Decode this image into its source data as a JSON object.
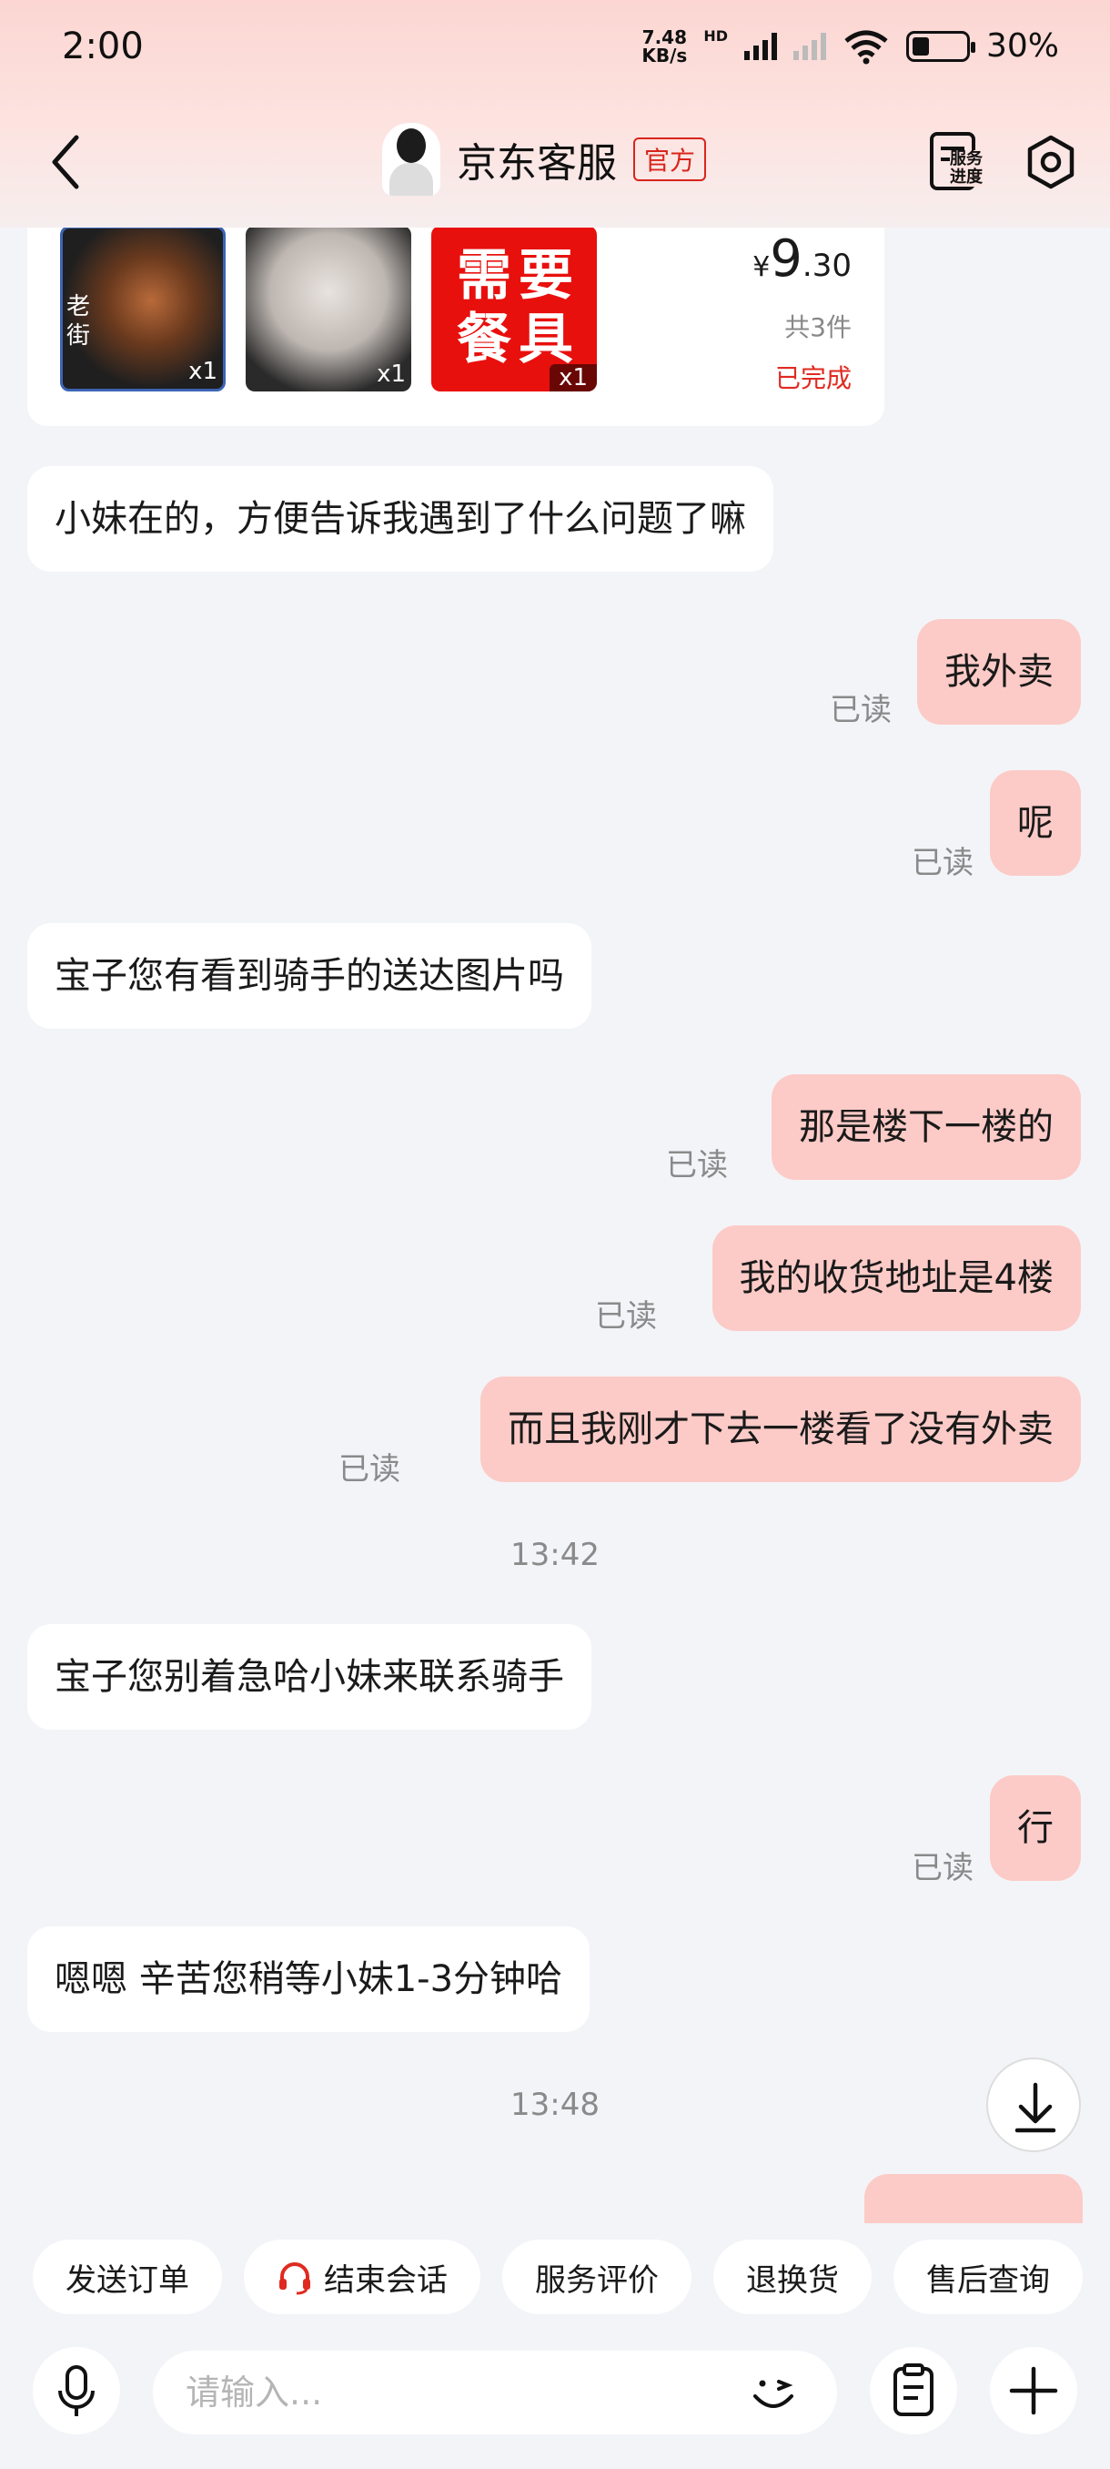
{
  "status_bar": {
    "time": "2:00",
    "net_speed_top": "7.48",
    "net_speed_bottom": "KB/s",
    "hd": "HD",
    "battery": "30%"
  },
  "header": {
    "title": "京东客服",
    "badge": "官方",
    "service_progress": "服务进度",
    "service_progress_line1": "服务",
    "service_progress_line2": "进度"
  },
  "order_card": {
    "items": [
      {
        "qty": "x1",
        "sign": "老街"
      },
      {
        "qty": "x1"
      },
      {
        "qty": "x1",
        "label": "需要餐具"
      }
    ],
    "thumb3_line1": "需要",
    "thumb3_line2": "餐具",
    "price_currency": "¥",
    "price_int": "9",
    "price_dec": ".30",
    "count": "共3件",
    "status": "已完成"
  },
  "messages": [
    {
      "side": "in",
      "text": "小妹在的，方便告诉我遇到了什么问题了嘛"
    },
    {
      "side": "out",
      "text": "我外卖",
      "read": "已读"
    },
    {
      "side": "out",
      "text": "呢",
      "read": "已读"
    },
    {
      "side": "in",
      "text": "宝子您有看到骑手的送达图片吗"
    },
    {
      "side": "out",
      "text": "那是楼下一楼的",
      "read": "已读"
    },
    {
      "side": "out",
      "text": "我的收货地址是4楼",
      "read": "已读"
    },
    {
      "side": "out",
      "text": "而且我刚才下去一楼看了没有外卖",
      "read": "已读"
    },
    {
      "side": "in",
      "text": "宝子您别着急哈小妹来联系骑手"
    },
    {
      "side": "out",
      "text": "行",
      "read": "已读"
    },
    {
      "side": "in",
      "text": "嗯嗯 辛苦您稍等小妹1-3分钟哈"
    }
  ],
  "timestamps": [
    "13:42",
    "13:48"
  ],
  "quick_actions": [
    "发送订单",
    "结束会话",
    "服务评价",
    "退换货",
    "售后查询"
  ],
  "input": {
    "placeholder": "请输入..."
  },
  "colors": {
    "accent": "#d9251b",
    "out_bubble": "#fccbc7",
    "background": "#f3f4f8"
  },
  "icons": [
    "back-icon",
    "service-progress-icon",
    "settings-icon",
    "scroll-down-icon",
    "headset-icon",
    "microphone-icon",
    "emoji-icon",
    "clipboard-icon",
    "plus-icon"
  ]
}
